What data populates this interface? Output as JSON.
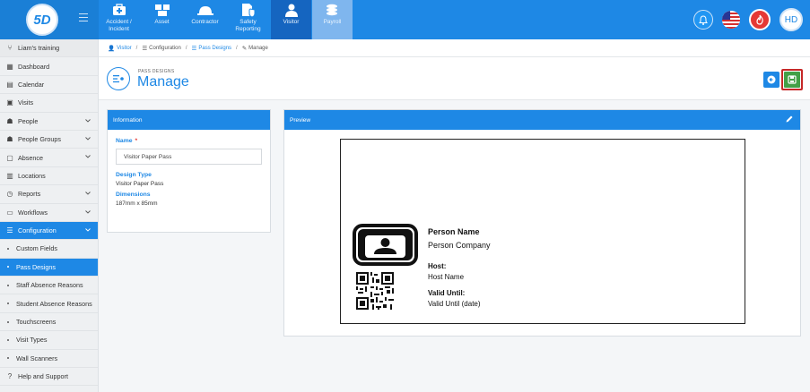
{
  "app": {
    "logo_text": "5D"
  },
  "nav": [
    {
      "label": "Accident / Incident",
      "icon": "medkit-icon"
    },
    {
      "label": "Asset",
      "icon": "asset-icon"
    },
    {
      "label": "Contractor",
      "icon": "hardhat-icon"
    },
    {
      "label": "Safety Reporting",
      "icon": "shield-icon"
    },
    {
      "label": "Visitor",
      "icon": "user-icon"
    },
    {
      "label": "Payroll",
      "icon": "coins-icon"
    }
  ],
  "topbar_right": {
    "avatar_initials": "HD"
  },
  "sidebar": {
    "training": "Liam's training",
    "items": [
      {
        "label": "Dashboard"
      },
      {
        "label": "Calendar"
      },
      {
        "label": "Visits"
      },
      {
        "label": "People"
      },
      {
        "label": "People Groups"
      },
      {
        "label": "Absence"
      },
      {
        "label": "Locations"
      },
      {
        "label": "Reports"
      },
      {
        "label": "Workflows"
      },
      {
        "label": "Configuration"
      },
      {
        "label": "Custom Fields"
      },
      {
        "label": "Pass Designs"
      },
      {
        "label": "Staff Absence Reasons"
      },
      {
        "label": "Student Absence Reasons"
      },
      {
        "label": "Touchscreens"
      },
      {
        "label": "Visit Types"
      },
      {
        "label": "Wall Scanners"
      },
      {
        "label": "Help and Support"
      }
    ]
  },
  "breadcrumb": [
    "Visitor",
    "Configuration",
    "Pass Designs",
    "Manage"
  ],
  "header": {
    "subtitle": "PASS DESIGNS",
    "title": "Manage"
  },
  "info": {
    "heading": "Information",
    "name_label": "Name",
    "required_mark": "*",
    "name_value": "Visitor Paper Pass",
    "design_type_label": "Design Type",
    "design_type_value": "Visitor Paper Pass",
    "dimensions_label": "Dimensions",
    "dimensions_value": "187mm x 85mm"
  },
  "preview": {
    "heading": "Preview",
    "person_name": "Person Name",
    "person_company": "Person Company",
    "host_label": "Host:",
    "host_value": "Host Name",
    "valid_label": "Valid Until:",
    "valid_value": "Valid Until (date)"
  },
  "colors": {
    "primary": "#1e88e5",
    "save": "#43a047",
    "alert": "#e53935"
  }
}
